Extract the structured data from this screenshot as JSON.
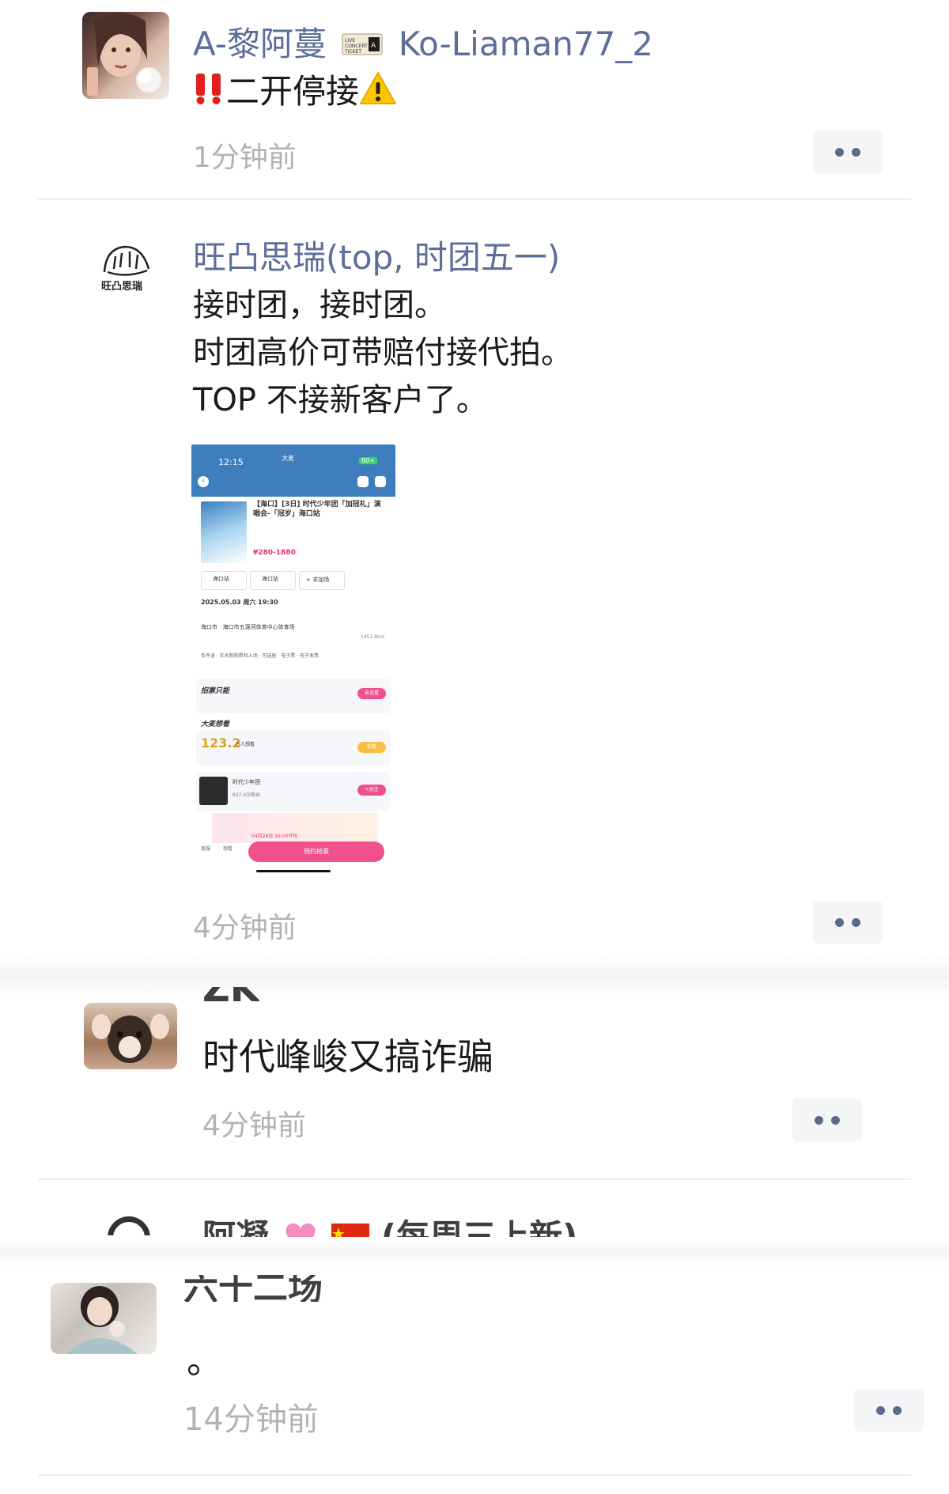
{
  "colors": {
    "name": "#5c6e9a",
    "time": "#b3b3b3",
    "separator": "#eeeeee",
    "more_button_bg": "#f4f5f7",
    "phone_header": "#3e7ebd",
    "phone_cta": "#f0508c"
  },
  "comments": [
    {
      "name": "A-黎阿蔓",
      "name_suffix": "Ko-Liaman77_2",
      "badge_icon": "concert-ticket-icon",
      "lead_icon": "double-exclamation-icon",
      "text": "二开停接",
      "trail_icon": "warning-icon",
      "time": "1分钟前"
    },
    {
      "name": "旺凸思瑞(top, 时团五一)",
      "avatar_text": "旺凸思瑞",
      "lines": [
        "接时团，接时团。",
        "时团高价可带赔付接代拍。",
        "TOP 不接新客户了。"
      ],
      "time": "4分钟前"
    },
    {
      "name_partial": "ZK",
      "text": "时代峰峻又搞诈骗",
      "time": "4分钟前"
    },
    {
      "name_partial": "阿凝",
      "name_tail": "(每周三上新)",
      "name_partial_2": "六十二场",
      "text": "。",
      "time": "14分钟前"
    }
  ],
  "screenshot": {
    "status_time": "12:15",
    "status_center": "大麦",
    "battery": "80+",
    "event_title": "【海口】[3日] 时代少年团「加冠礼」演唱会-「冠岁」海口站",
    "price": "¥280-1880",
    "station_1": "海口站",
    "station_2": "海口站",
    "add_station": "+ 求加场",
    "date": "2025.05.03 周六 19:30",
    "venue": "海口市 · 海口市五源河体育中心体育场",
    "distance": "1451.8km",
    "tags": [
      "条件退",
      "实名制购票和入场",
      "可选座",
      "电子票",
      "电子发票"
    ],
    "section_1": "招票只能",
    "section_1_btn": "去设置",
    "section_2": "大麦想看",
    "want_count": "123.2",
    "want_unit": "万人想看",
    "want_btn": "想看",
    "artist": "时代少年团",
    "artist_fans": "637.4万粉丝",
    "follow_btn": "+关注",
    "countdown_date": "04月28日 16:00开抢",
    "cta": "预约抢票",
    "bottom_left_1": "客服",
    "bottom_left_2": "想看"
  }
}
